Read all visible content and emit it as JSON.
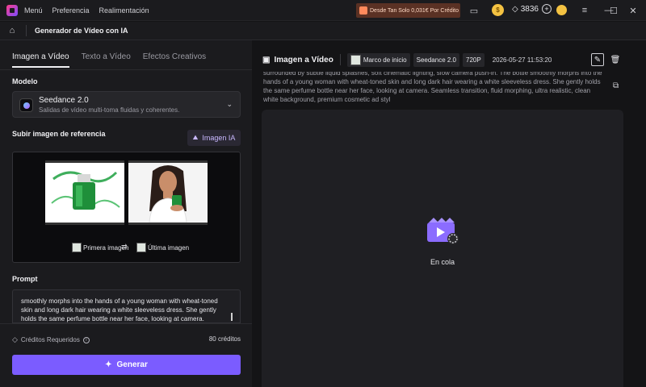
{
  "titlebar": {
    "menu": [
      "Menú",
      "Preferencia",
      "Realimentación"
    ],
    "promo": "Desde Tan Solo 0,031€ Por Crédito",
    "credits": "3836"
  },
  "nav": {
    "title": "Generador de Vídeo con IA"
  },
  "left": {
    "tabs": [
      "Imagen a Vídeo",
      "Texto a Vídeo",
      "Efectos Creativos"
    ],
    "model_label": "Modelo",
    "model_name": "Seedance 2.0",
    "model_desc": "Salidas de vídeo multi-toma fluidas y coherentes.",
    "upload_label": "Subir imagen de referencia",
    "imagen_ia": "Imagen IA",
    "first_image": "Primera imagen",
    "last_image": "Última imagen",
    "prompt_label": "Prompt",
    "prompt_text": "smoothly morphs into the hands of a young woman with wheat-toned skin and long dark hair wearing a white sleeveless dress. She gently holds the same perfume bottle near her face, looking at camera. Seamless transition, fluid morphing, ultra realistic, clean white background",
    "credits_required": "Créditos Requeridos",
    "credits_amount": "80 créditos",
    "generate": "Generar"
  },
  "right": {
    "title": "Imagen a Vídeo",
    "chip_frame": "Marco de inicio",
    "chip_model": "Seedance 2.0",
    "chip_res": "720P",
    "date": "2026-05-27 11:53:20",
    "prompt": "surrounded by subtle liquid splashes, soft cinematic lighting, slow camera push-in. The bottle smoothly morphs into the hands of a young woman with wheat-toned skin and long dark hair wearing a white sleeveless dress. She gently holds the same perfume bottle near her face, looking at camera. Seamless transition, fluid morphing, ultra realistic, clean white background, premium cosmetic ad styl",
    "status": "En cola"
  },
  "colors": {
    "accent": "#7b5cff",
    "promo_bg": "#5a3124",
    "panel": "#1b1b1e",
    "background": "#141416"
  }
}
